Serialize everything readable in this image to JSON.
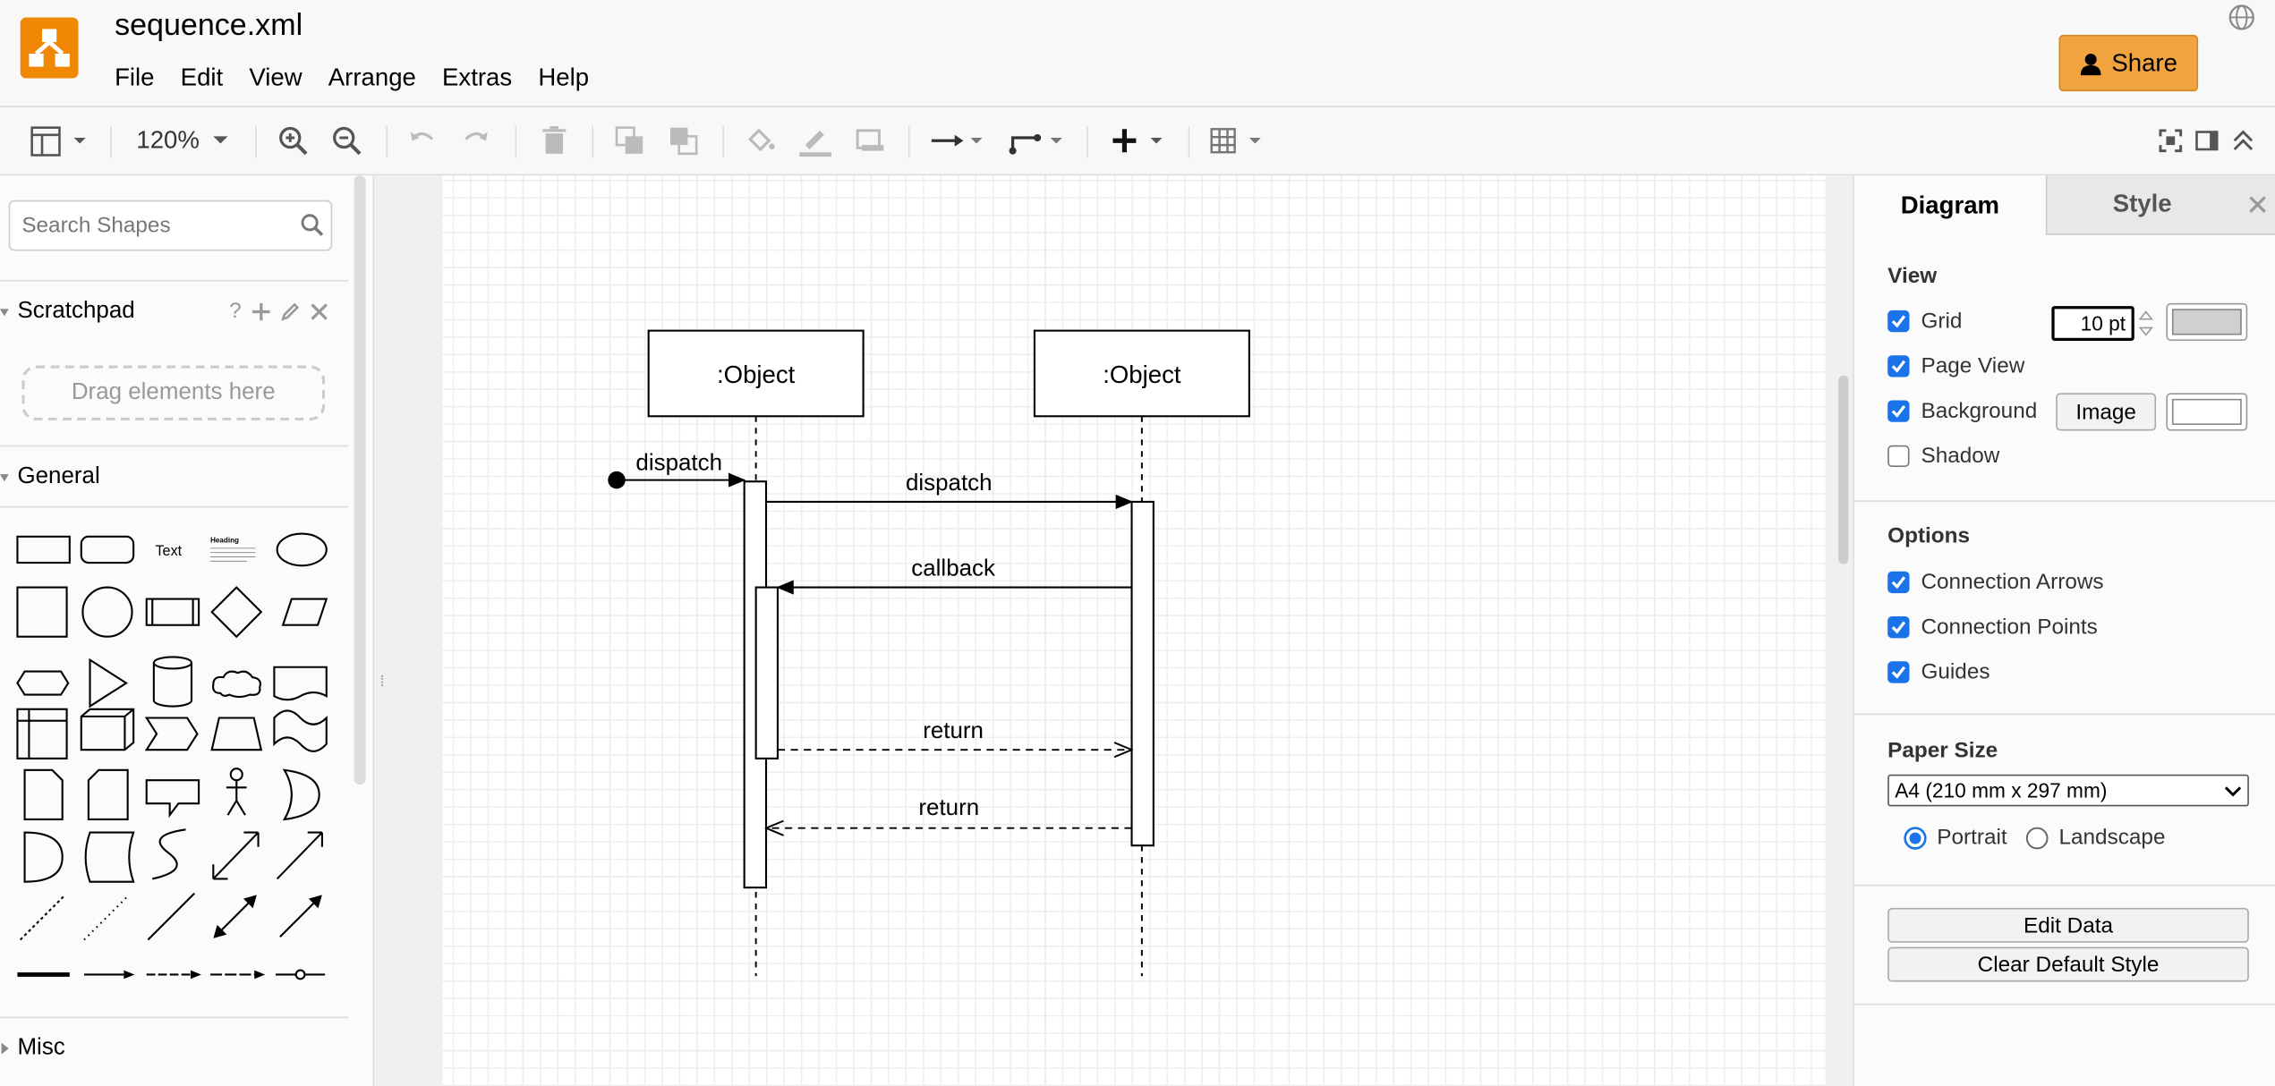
{
  "header": {
    "title": "sequence.xml",
    "menu": [
      "File",
      "Edit",
      "View",
      "Arrange",
      "Extras",
      "Help"
    ],
    "share_label": "Share"
  },
  "toolbar": {
    "zoom": "120%"
  },
  "left_panel": {
    "search_placeholder": "Search Shapes",
    "scratchpad_label": "Scratchpad",
    "scratchpad_help": "?",
    "drag_hint": "Drag elements here",
    "general_label": "General",
    "text_shape_label": "Text",
    "heading_shape_label": "Heading",
    "misc_label": "Misc"
  },
  "diagram": {
    "lifelines": [
      ":Object",
      ":Object"
    ],
    "messages": [
      "dispatch",
      "dispatch",
      "callback",
      "return",
      "return"
    ]
  },
  "right_panel": {
    "tabs": [
      "Diagram",
      "Style"
    ],
    "view_heading": "View",
    "view_options": [
      {
        "label": "Grid",
        "checked": true
      },
      {
        "label": "Page View",
        "checked": true
      },
      {
        "label": "Background",
        "checked": true
      },
      {
        "label": "Shadow",
        "checked": false
      }
    ],
    "grid_size": "10 pt",
    "image_button": "Image",
    "options_heading": "Options",
    "options": [
      {
        "label": "Connection Arrows",
        "checked": true
      },
      {
        "label": "Connection Points",
        "checked": true
      },
      {
        "label": "Guides",
        "checked": true
      }
    ],
    "paper_heading": "Paper Size",
    "paper_size": "A4 (210 mm x 297 mm)",
    "orientation": {
      "portrait": "Portrait",
      "landscape": "Landscape",
      "selected": "portrait"
    },
    "edit_data": "Edit Data",
    "clear_style": "Clear Default Style"
  },
  "colors": {
    "accent": "#f08705",
    "checkbox": "#1a73e8",
    "share": "#f1a340"
  }
}
